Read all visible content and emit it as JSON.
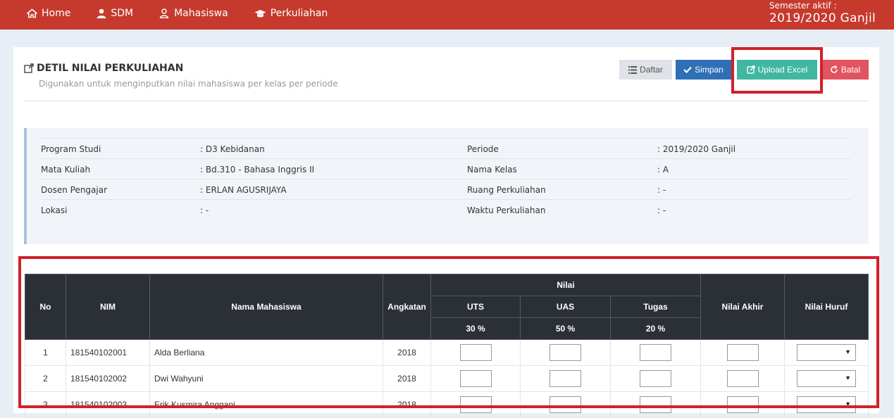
{
  "nav": {
    "items": [
      {
        "label": "Home",
        "icon": "home-icon"
      },
      {
        "label": "SDM",
        "icon": "user-icon"
      },
      {
        "label": "Mahasiswa",
        "icon": "users-icon"
      },
      {
        "label": "Perkuliahan",
        "icon": "graduation-cap-icon"
      }
    ],
    "semester_label": "Semester aktif :",
    "semester_value": "2019/2020 Ganjil"
  },
  "page": {
    "title": "DETIL NILAI PERKULIAHAN",
    "subtitle": "Digunakan untuk menginputkan nilai mahasiswa per kelas per periode"
  },
  "buttons": {
    "daftar": "Daftar",
    "simpan": "Simpan",
    "upload": "Upload Excel",
    "batal": "Batal"
  },
  "info": [
    {
      "l1": "Program Studi",
      "v1": ": D3 Kebidanan",
      "l2": "Periode",
      "v2": ": 2019/2020 Ganjil"
    },
    {
      "l1": "Mata Kuliah",
      "v1": ": Bd.310 - Bahasa Inggris II",
      "l2": "Nama Kelas",
      "v2": ": A"
    },
    {
      "l1": "Dosen Pengajar",
      "v1": ": ERLAN AGUSRIJAYA",
      "l2": "Ruang Perkuliahan",
      "v2": ": -"
    },
    {
      "l1": "Lokasi",
      "v1": ": -",
      "l2": "Waktu Perkuliahan",
      "v2": ": -"
    }
  ],
  "table": {
    "headers": {
      "no": "No",
      "nim": "NIM",
      "nama": "Nama Mahasiswa",
      "angkatan": "Angkatan",
      "nilai": "Nilai",
      "uts": "UTS",
      "uas": "UAS",
      "tugas": "Tugas",
      "uts_pct": "30 %",
      "uas_pct": "50 %",
      "tugas_pct": "20 %",
      "akhir": "Nilai Akhir",
      "huruf": "Nilai Huruf"
    },
    "rows": [
      {
        "no": "1",
        "nim": "181540102001",
        "nama": "Alda Berliana",
        "angkatan": "2018"
      },
      {
        "no": "2",
        "nim": "181540102002",
        "nama": "Dwi Wahyuni",
        "angkatan": "2018"
      },
      {
        "no": "3",
        "nim": "181540102003",
        "nama": "Erik Kusmira Anggani",
        "angkatan": "2018"
      }
    ]
  },
  "colors": {
    "navbar": "#c63a2e",
    "simpan": "#2f6fb6",
    "upload": "#3fb7a1",
    "batal": "#e15460",
    "highlight": "#d3202a",
    "table_header": "#2b2f36"
  }
}
